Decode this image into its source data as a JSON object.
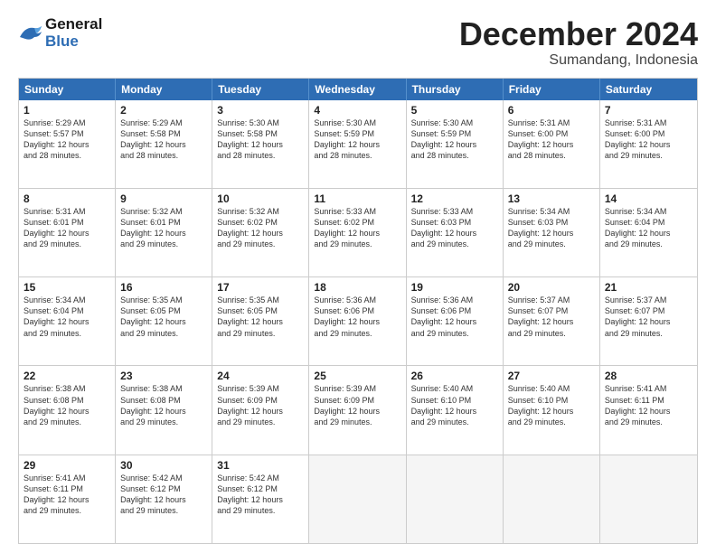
{
  "header": {
    "logo_general": "General",
    "logo_blue": "Blue",
    "title": "December 2024",
    "subtitle": "Sumandang, Indonesia"
  },
  "days": [
    "Sunday",
    "Monday",
    "Tuesday",
    "Wednesday",
    "Thursday",
    "Friday",
    "Saturday"
  ],
  "weeks": [
    [
      {
        "num": "1",
        "text": "Sunrise: 5:29 AM\nSunset: 5:57 PM\nDaylight: 12 hours\nand 28 minutes."
      },
      {
        "num": "2",
        "text": "Sunrise: 5:29 AM\nSunset: 5:58 PM\nDaylight: 12 hours\nand 28 minutes."
      },
      {
        "num": "3",
        "text": "Sunrise: 5:30 AM\nSunset: 5:58 PM\nDaylight: 12 hours\nand 28 minutes."
      },
      {
        "num": "4",
        "text": "Sunrise: 5:30 AM\nSunset: 5:59 PM\nDaylight: 12 hours\nand 28 minutes."
      },
      {
        "num": "5",
        "text": "Sunrise: 5:30 AM\nSunset: 5:59 PM\nDaylight: 12 hours\nand 28 minutes."
      },
      {
        "num": "6",
        "text": "Sunrise: 5:31 AM\nSunset: 6:00 PM\nDaylight: 12 hours\nand 28 minutes."
      },
      {
        "num": "7",
        "text": "Sunrise: 5:31 AM\nSunset: 6:00 PM\nDaylight: 12 hours\nand 29 minutes."
      }
    ],
    [
      {
        "num": "8",
        "text": "Sunrise: 5:31 AM\nSunset: 6:01 PM\nDaylight: 12 hours\nand 29 minutes."
      },
      {
        "num": "9",
        "text": "Sunrise: 5:32 AM\nSunset: 6:01 PM\nDaylight: 12 hours\nand 29 minutes."
      },
      {
        "num": "10",
        "text": "Sunrise: 5:32 AM\nSunset: 6:02 PM\nDaylight: 12 hours\nand 29 minutes."
      },
      {
        "num": "11",
        "text": "Sunrise: 5:33 AM\nSunset: 6:02 PM\nDaylight: 12 hours\nand 29 minutes."
      },
      {
        "num": "12",
        "text": "Sunrise: 5:33 AM\nSunset: 6:03 PM\nDaylight: 12 hours\nand 29 minutes."
      },
      {
        "num": "13",
        "text": "Sunrise: 5:34 AM\nSunset: 6:03 PM\nDaylight: 12 hours\nand 29 minutes."
      },
      {
        "num": "14",
        "text": "Sunrise: 5:34 AM\nSunset: 6:04 PM\nDaylight: 12 hours\nand 29 minutes."
      }
    ],
    [
      {
        "num": "15",
        "text": "Sunrise: 5:34 AM\nSunset: 6:04 PM\nDaylight: 12 hours\nand 29 minutes."
      },
      {
        "num": "16",
        "text": "Sunrise: 5:35 AM\nSunset: 6:05 PM\nDaylight: 12 hours\nand 29 minutes."
      },
      {
        "num": "17",
        "text": "Sunrise: 5:35 AM\nSunset: 6:05 PM\nDaylight: 12 hours\nand 29 minutes."
      },
      {
        "num": "18",
        "text": "Sunrise: 5:36 AM\nSunset: 6:06 PM\nDaylight: 12 hours\nand 29 minutes."
      },
      {
        "num": "19",
        "text": "Sunrise: 5:36 AM\nSunset: 6:06 PM\nDaylight: 12 hours\nand 29 minutes."
      },
      {
        "num": "20",
        "text": "Sunrise: 5:37 AM\nSunset: 6:07 PM\nDaylight: 12 hours\nand 29 minutes."
      },
      {
        "num": "21",
        "text": "Sunrise: 5:37 AM\nSunset: 6:07 PM\nDaylight: 12 hours\nand 29 minutes."
      }
    ],
    [
      {
        "num": "22",
        "text": "Sunrise: 5:38 AM\nSunset: 6:08 PM\nDaylight: 12 hours\nand 29 minutes."
      },
      {
        "num": "23",
        "text": "Sunrise: 5:38 AM\nSunset: 6:08 PM\nDaylight: 12 hours\nand 29 minutes."
      },
      {
        "num": "24",
        "text": "Sunrise: 5:39 AM\nSunset: 6:09 PM\nDaylight: 12 hours\nand 29 minutes."
      },
      {
        "num": "25",
        "text": "Sunrise: 5:39 AM\nSunset: 6:09 PM\nDaylight: 12 hours\nand 29 minutes."
      },
      {
        "num": "26",
        "text": "Sunrise: 5:40 AM\nSunset: 6:10 PM\nDaylight: 12 hours\nand 29 minutes."
      },
      {
        "num": "27",
        "text": "Sunrise: 5:40 AM\nSunset: 6:10 PM\nDaylight: 12 hours\nand 29 minutes."
      },
      {
        "num": "28",
        "text": "Sunrise: 5:41 AM\nSunset: 6:11 PM\nDaylight: 12 hours\nand 29 minutes."
      }
    ],
    [
      {
        "num": "29",
        "text": "Sunrise: 5:41 AM\nSunset: 6:11 PM\nDaylight: 12 hours\nand 29 minutes."
      },
      {
        "num": "30",
        "text": "Sunrise: 5:42 AM\nSunset: 6:12 PM\nDaylight: 12 hours\nand 29 minutes."
      },
      {
        "num": "31",
        "text": "Sunrise: 5:42 AM\nSunset: 6:12 PM\nDaylight: 12 hours\nand 29 minutes."
      },
      {
        "num": "",
        "text": ""
      },
      {
        "num": "",
        "text": ""
      },
      {
        "num": "",
        "text": ""
      },
      {
        "num": "",
        "text": ""
      }
    ]
  ]
}
